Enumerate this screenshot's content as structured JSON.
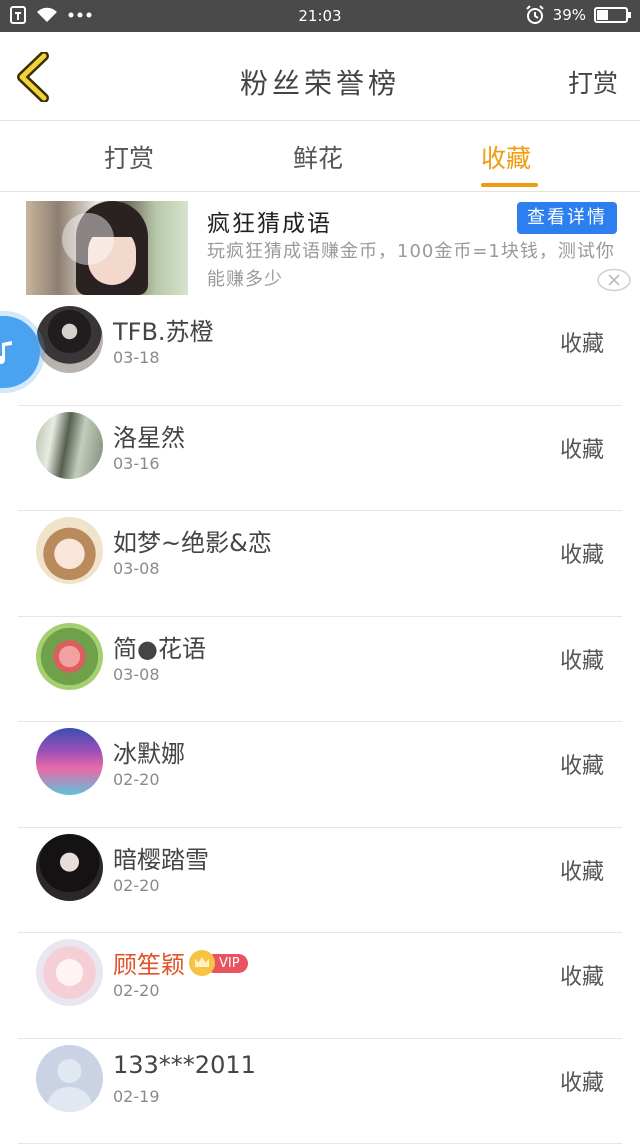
{
  "status_bar": {
    "time": "21:03",
    "battery": "39%",
    "battery_level": 0.39
  },
  "header": {
    "title": "粉丝荣誉榜",
    "right_action": "打赏"
  },
  "tabs": [
    {
      "label": "打赏",
      "active": false
    },
    {
      "label": "鲜花",
      "active": false
    },
    {
      "label": "收藏",
      "active": true
    }
  ],
  "ad": {
    "title": "疯狂猜成语",
    "button": "查看详情",
    "description": "玩疯狂猜成语赚金币，100金币=1块钱，测试你能赚多少"
  },
  "fans": [
    {
      "name": "TFB.苏橙",
      "date": "03-18",
      "action": "收藏"
    },
    {
      "name": "洛星然",
      "date": "03-16",
      "action": "收藏"
    },
    {
      "name": "如梦~绝影&恋",
      "date": "03-08",
      "action": "收藏"
    },
    {
      "name": "简●花语",
      "date": "03-08",
      "action": "收藏"
    },
    {
      "name": "冰默娜",
      "date": "02-20",
      "action": "收藏"
    },
    {
      "name": "暗樱踏雪",
      "date": "02-20",
      "action": "收藏"
    },
    {
      "name": "顾笙颖",
      "date": "02-20",
      "action": "收藏",
      "vip": "VIP"
    },
    {
      "name": "133***2011",
      "date": "02-19",
      "action": "收藏"
    }
  ],
  "colors": {
    "accent": "#f19c10",
    "ad_button": "#2d7ff0",
    "vip_name": "#e0532a"
  }
}
